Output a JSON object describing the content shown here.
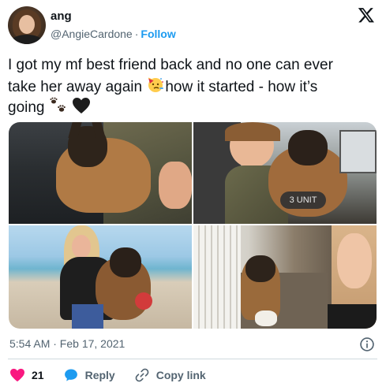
{
  "author": {
    "display_name": "ang",
    "handle": "@AngieCardone",
    "separator": "·",
    "follow_label": "Follow"
  },
  "tweet": {
    "line1": "I got my mf best friend back and no one can ever",
    "line2_a": "take her away again",
    "line2_b": "how it started - how it’s",
    "line3": "going"
  },
  "media": {
    "photo1_patch": "",
    "photo2_patch": "3 UNIT"
  },
  "footer": {
    "timestamp": "5:54 AM · Feb 17, 2021"
  },
  "actions": {
    "like_count": "21",
    "reply_label": "Reply",
    "copy_link_label": "Copy link"
  },
  "colors": {
    "accent": "#1d9bf0",
    "like": "#f91880",
    "muted": "#536471",
    "text": "#0f1419"
  },
  "icons": [
    "x-logo-icon",
    "party-face-icon",
    "paw-prints-icon",
    "black-heart-icon",
    "info-icon",
    "heart-icon",
    "reply-bubble-icon",
    "link-icon"
  ]
}
